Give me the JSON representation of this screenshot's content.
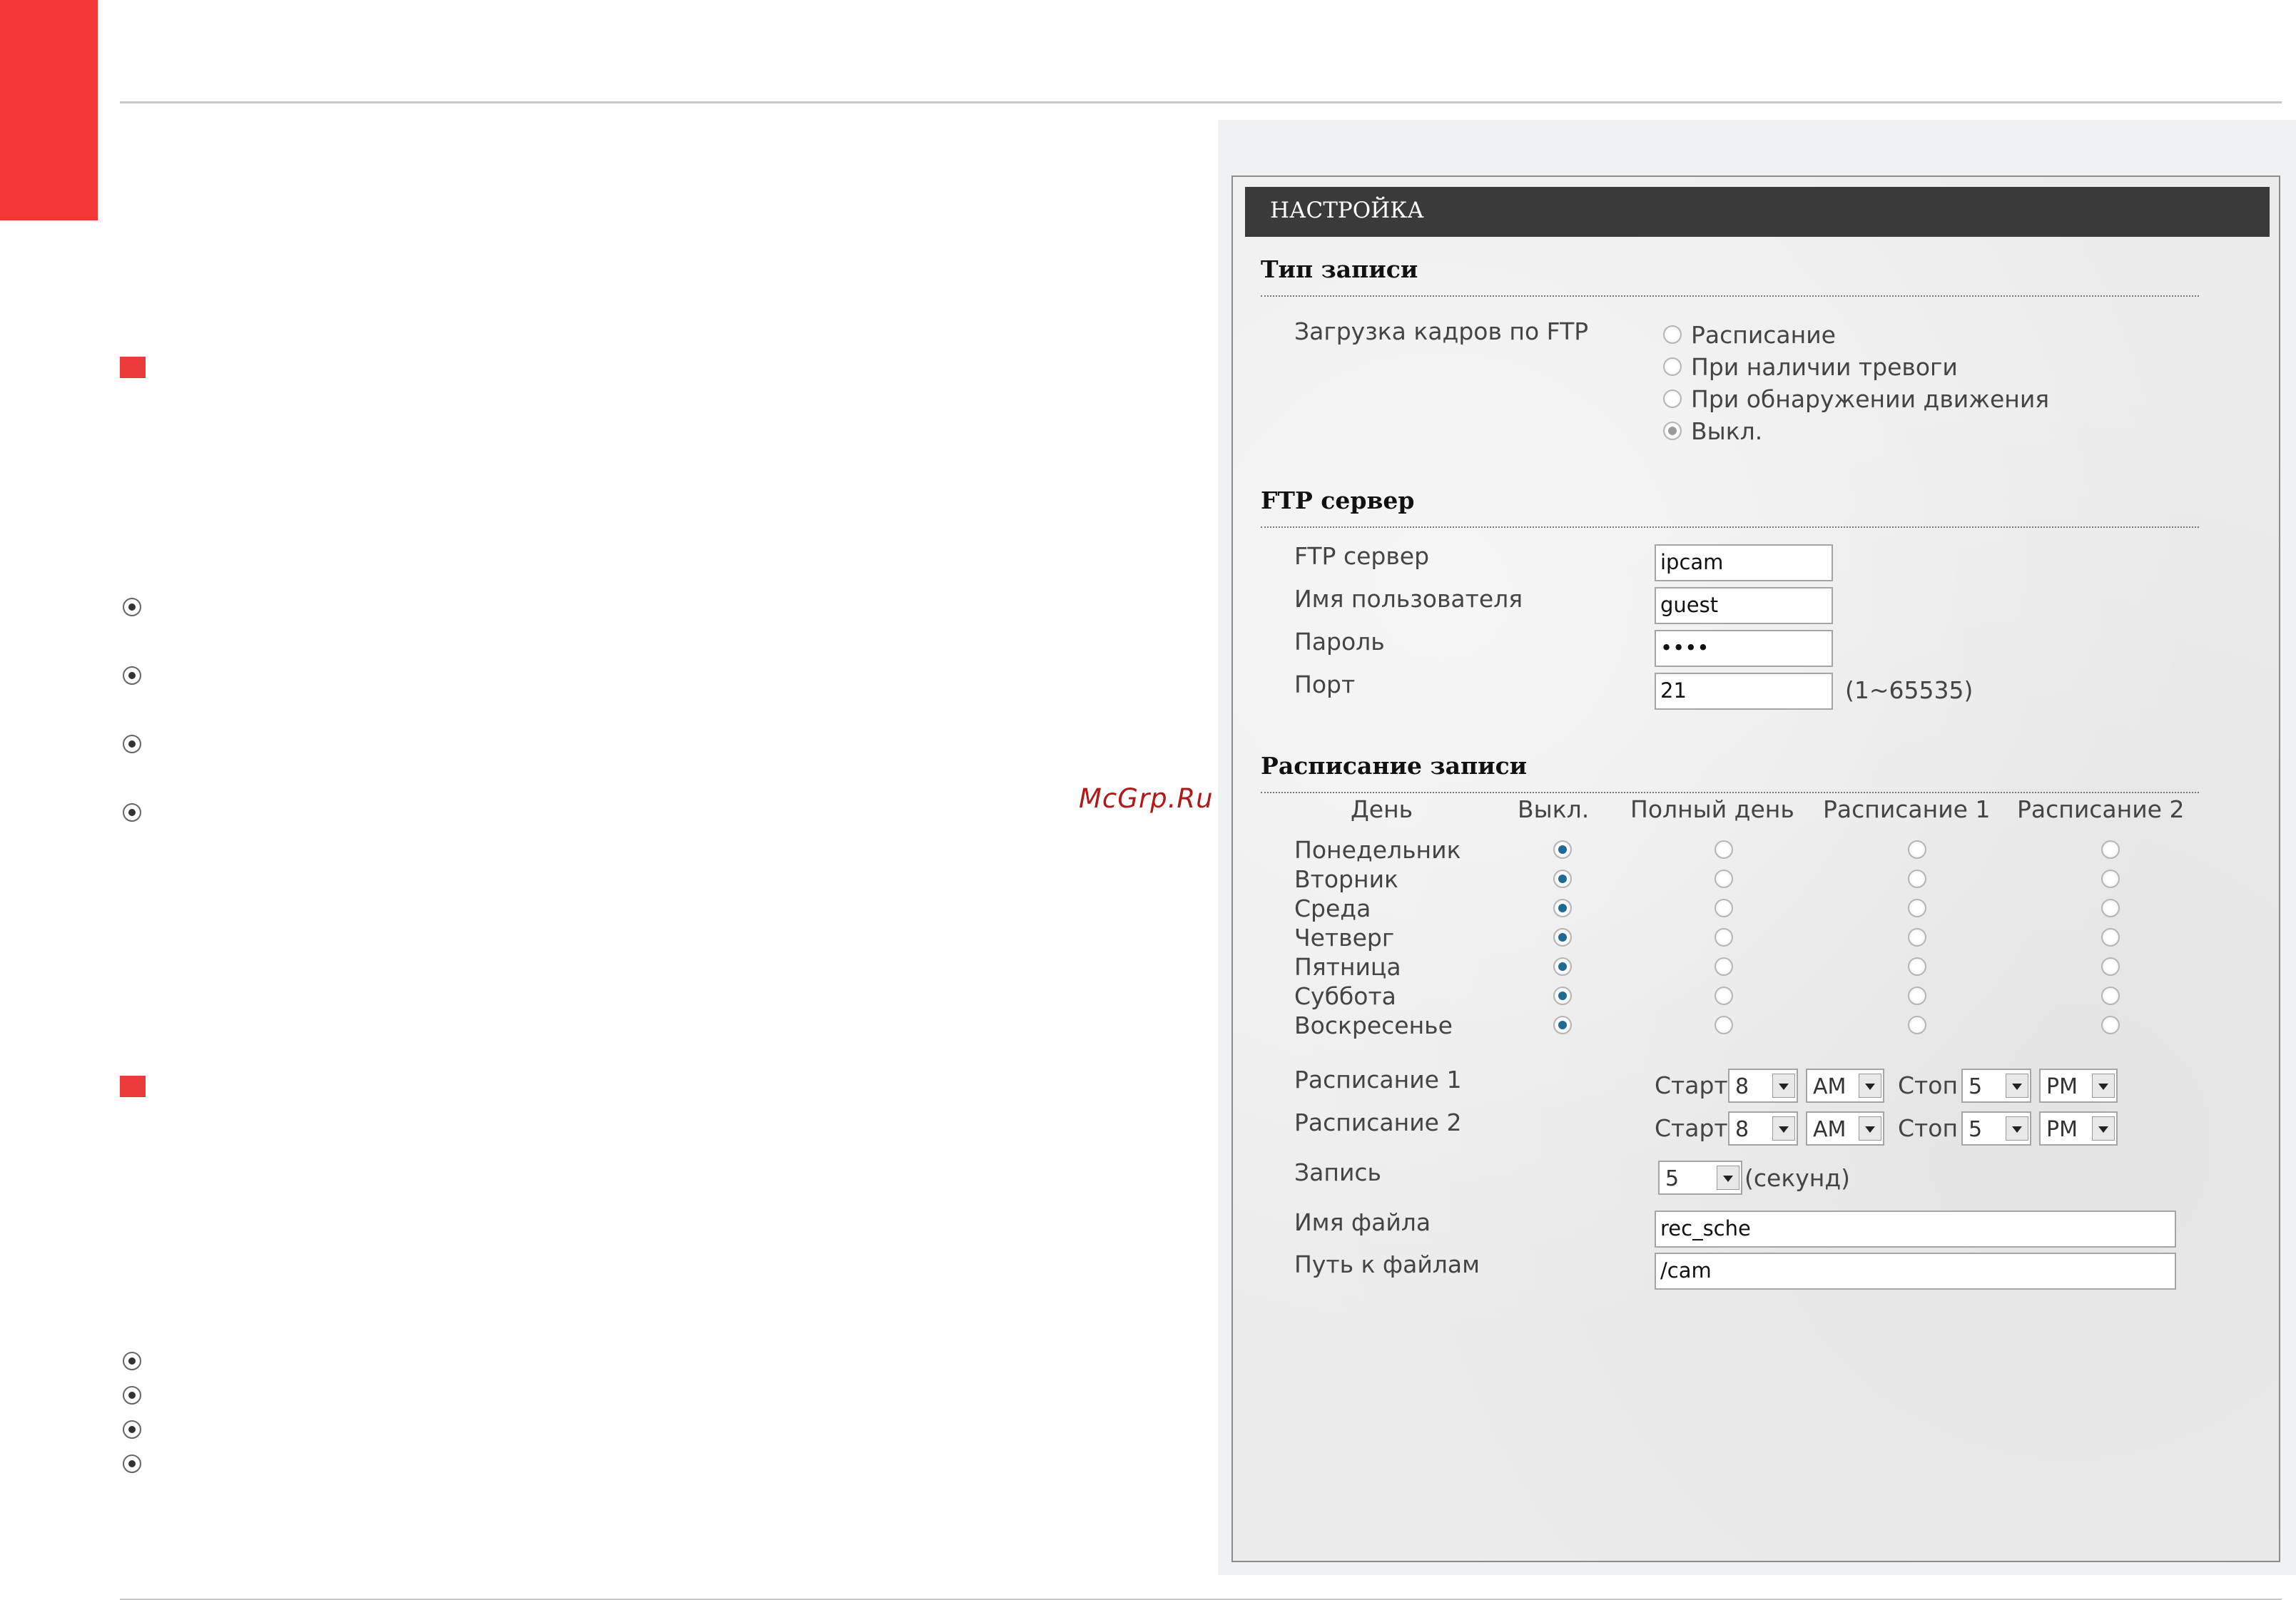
{
  "watermark": "McGrp.Ru",
  "panel": {
    "title": "НАСТРОЙКА"
  },
  "record_type": {
    "heading": "Тип записи",
    "label": "Загрузка кадров по FTP",
    "options": [
      "Расписание",
      "При наличии тревоги",
      "При обнаружении движения",
      "Выкл."
    ],
    "selected": "Выкл."
  },
  "ftp": {
    "heading": "FTP сервер",
    "server_label": "FTP сервер",
    "server_value": "ipcam",
    "user_label": "Имя пользователя",
    "user_value": "guest",
    "password_label": "Пароль",
    "password_value": "••••",
    "port_label": "Порт",
    "port_value": "21",
    "port_hint": "(1~65535)"
  },
  "schedule": {
    "heading": "Расписание записи",
    "columns": [
      "День",
      "Выкл.",
      "Полный день",
      "Расписание 1",
      "Расписание 2"
    ],
    "days": [
      "Понедельник",
      "Вторник",
      "Среда",
      "Четверг",
      "Пятница",
      "Суббота",
      "Воскресенье"
    ],
    "selected_column": "Выкл.",
    "sched1": {
      "label": "Расписание 1",
      "start_label": "Старт",
      "start_hour": "8",
      "start_ampm": "AM",
      "stop_label": "Стоп",
      "stop_hour": "5",
      "stop_ampm": "PM"
    },
    "sched2": {
      "label": "Расписание 2",
      "start_label": "Старт",
      "start_hour": "8",
      "start_ampm": "AM",
      "stop_label": "Стоп",
      "stop_hour": "5",
      "stop_ampm": "PM"
    },
    "record_label": "Запись",
    "record_value": "5",
    "record_unit": "(секунд)",
    "filename_label": "Имя файла",
    "filename_value": "rec_sche",
    "path_label": "Путь к файлам",
    "path_value": "/cam"
  },
  "colors": {
    "accent_red": "#f23535",
    "header_dark": "#3a3a3a",
    "radio_selected": "#1e6a96",
    "watermark": "#b31818"
  }
}
